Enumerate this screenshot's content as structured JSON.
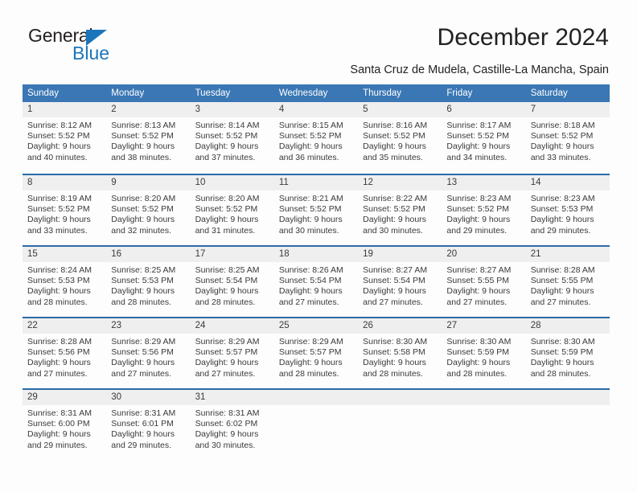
{
  "brand": {
    "name_top": "General",
    "name_bottom": "Blue",
    "accent_color": "#1b75bb"
  },
  "header": {
    "title": "December 2024",
    "subtitle": "Santa Cruz de Mudela, Castille-La Mancha, Spain"
  },
  "theme": {
    "header_bg": "#3a77b4",
    "row_divider": "#2c6aa8",
    "daynum_bg": "#efefef",
    "text": "#3a3a3a"
  },
  "calendar": {
    "weekday_headers": [
      "Sunday",
      "Monday",
      "Tuesday",
      "Wednesday",
      "Thursday",
      "Friday",
      "Saturday"
    ],
    "weeks": [
      [
        {
          "day": "1",
          "sunrise": "Sunrise: 8:12 AM",
          "sunset": "Sunset: 5:52 PM",
          "daylight1": "Daylight: 9 hours",
          "daylight2": "and 40 minutes."
        },
        {
          "day": "2",
          "sunrise": "Sunrise: 8:13 AM",
          "sunset": "Sunset: 5:52 PM",
          "daylight1": "Daylight: 9 hours",
          "daylight2": "and 38 minutes."
        },
        {
          "day": "3",
          "sunrise": "Sunrise: 8:14 AM",
          "sunset": "Sunset: 5:52 PM",
          "daylight1": "Daylight: 9 hours",
          "daylight2": "and 37 minutes."
        },
        {
          "day": "4",
          "sunrise": "Sunrise: 8:15 AM",
          "sunset": "Sunset: 5:52 PM",
          "daylight1": "Daylight: 9 hours",
          "daylight2": "and 36 minutes."
        },
        {
          "day": "5",
          "sunrise": "Sunrise: 8:16 AM",
          "sunset": "Sunset: 5:52 PM",
          "daylight1": "Daylight: 9 hours",
          "daylight2": "and 35 minutes."
        },
        {
          "day": "6",
          "sunrise": "Sunrise: 8:17 AM",
          "sunset": "Sunset: 5:52 PM",
          "daylight1": "Daylight: 9 hours",
          "daylight2": "and 34 minutes."
        },
        {
          "day": "7",
          "sunrise": "Sunrise: 8:18 AM",
          "sunset": "Sunset: 5:52 PM",
          "daylight1": "Daylight: 9 hours",
          "daylight2": "and 33 minutes."
        }
      ],
      [
        {
          "day": "8",
          "sunrise": "Sunrise: 8:19 AM",
          "sunset": "Sunset: 5:52 PM",
          "daylight1": "Daylight: 9 hours",
          "daylight2": "and 33 minutes."
        },
        {
          "day": "9",
          "sunrise": "Sunrise: 8:20 AM",
          "sunset": "Sunset: 5:52 PM",
          "daylight1": "Daylight: 9 hours",
          "daylight2": "and 32 minutes."
        },
        {
          "day": "10",
          "sunrise": "Sunrise: 8:20 AM",
          "sunset": "Sunset: 5:52 PM",
          "daylight1": "Daylight: 9 hours",
          "daylight2": "and 31 minutes."
        },
        {
          "day": "11",
          "sunrise": "Sunrise: 8:21 AM",
          "sunset": "Sunset: 5:52 PM",
          "daylight1": "Daylight: 9 hours",
          "daylight2": "and 30 minutes."
        },
        {
          "day": "12",
          "sunrise": "Sunrise: 8:22 AM",
          "sunset": "Sunset: 5:52 PM",
          "daylight1": "Daylight: 9 hours",
          "daylight2": "and 30 minutes."
        },
        {
          "day": "13",
          "sunrise": "Sunrise: 8:23 AM",
          "sunset": "Sunset: 5:52 PM",
          "daylight1": "Daylight: 9 hours",
          "daylight2": "and 29 minutes."
        },
        {
          "day": "14",
          "sunrise": "Sunrise: 8:23 AM",
          "sunset": "Sunset: 5:53 PM",
          "daylight1": "Daylight: 9 hours",
          "daylight2": "and 29 minutes."
        }
      ],
      [
        {
          "day": "15",
          "sunrise": "Sunrise: 8:24 AM",
          "sunset": "Sunset: 5:53 PM",
          "daylight1": "Daylight: 9 hours",
          "daylight2": "and 28 minutes."
        },
        {
          "day": "16",
          "sunrise": "Sunrise: 8:25 AM",
          "sunset": "Sunset: 5:53 PM",
          "daylight1": "Daylight: 9 hours",
          "daylight2": "and 28 minutes."
        },
        {
          "day": "17",
          "sunrise": "Sunrise: 8:25 AM",
          "sunset": "Sunset: 5:54 PM",
          "daylight1": "Daylight: 9 hours",
          "daylight2": "and 28 minutes."
        },
        {
          "day": "18",
          "sunrise": "Sunrise: 8:26 AM",
          "sunset": "Sunset: 5:54 PM",
          "daylight1": "Daylight: 9 hours",
          "daylight2": "and 27 minutes."
        },
        {
          "day": "19",
          "sunrise": "Sunrise: 8:27 AM",
          "sunset": "Sunset: 5:54 PM",
          "daylight1": "Daylight: 9 hours",
          "daylight2": "and 27 minutes."
        },
        {
          "day": "20",
          "sunrise": "Sunrise: 8:27 AM",
          "sunset": "Sunset: 5:55 PM",
          "daylight1": "Daylight: 9 hours",
          "daylight2": "and 27 minutes."
        },
        {
          "day": "21",
          "sunrise": "Sunrise: 8:28 AM",
          "sunset": "Sunset: 5:55 PM",
          "daylight1": "Daylight: 9 hours",
          "daylight2": "and 27 minutes."
        }
      ],
      [
        {
          "day": "22",
          "sunrise": "Sunrise: 8:28 AM",
          "sunset": "Sunset: 5:56 PM",
          "daylight1": "Daylight: 9 hours",
          "daylight2": "and 27 minutes."
        },
        {
          "day": "23",
          "sunrise": "Sunrise: 8:29 AM",
          "sunset": "Sunset: 5:56 PM",
          "daylight1": "Daylight: 9 hours",
          "daylight2": "and 27 minutes."
        },
        {
          "day": "24",
          "sunrise": "Sunrise: 8:29 AM",
          "sunset": "Sunset: 5:57 PM",
          "daylight1": "Daylight: 9 hours",
          "daylight2": "and 27 minutes."
        },
        {
          "day": "25",
          "sunrise": "Sunrise: 8:29 AM",
          "sunset": "Sunset: 5:57 PM",
          "daylight1": "Daylight: 9 hours",
          "daylight2": "and 28 minutes."
        },
        {
          "day": "26",
          "sunrise": "Sunrise: 8:30 AM",
          "sunset": "Sunset: 5:58 PM",
          "daylight1": "Daylight: 9 hours",
          "daylight2": "and 28 minutes."
        },
        {
          "day": "27",
          "sunrise": "Sunrise: 8:30 AM",
          "sunset": "Sunset: 5:59 PM",
          "daylight1": "Daylight: 9 hours",
          "daylight2": "and 28 minutes."
        },
        {
          "day": "28",
          "sunrise": "Sunrise: 8:30 AM",
          "sunset": "Sunset: 5:59 PM",
          "daylight1": "Daylight: 9 hours",
          "daylight2": "and 28 minutes."
        }
      ],
      [
        {
          "day": "29",
          "sunrise": "Sunrise: 8:31 AM",
          "sunset": "Sunset: 6:00 PM",
          "daylight1": "Daylight: 9 hours",
          "daylight2": "and 29 minutes."
        },
        {
          "day": "30",
          "sunrise": "Sunrise: 8:31 AM",
          "sunset": "Sunset: 6:01 PM",
          "daylight1": "Daylight: 9 hours",
          "daylight2": "and 29 minutes."
        },
        {
          "day": "31",
          "sunrise": "Sunrise: 8:31 AM",
          "sunset": "Sunset: 6:02 PM",
          "daylight1": "Daylight: 9 hours",
          "daylight2": "and 30 minutes."
        },
        {
          "day": "",
          "sunrise": "",
          "sunset": "",
          "daylight1": "",
          "daylight2": ""
        },
        {
          "day": "",
          "sunrise": "",
          "sunset": "",
          "daylight1": "",
          "daylight2": ""
        },
        {
          "day": "",
          "sunrise": "",
          "sunset": "",
          "daylight1": "",
          "daylight2": ""
        },
        {
          "day": "",
          "sunrise": "",
          "sunset": "",
          "daylight1": "",
          "daylight2": ""
        }
      ]
    ]
  }
}
